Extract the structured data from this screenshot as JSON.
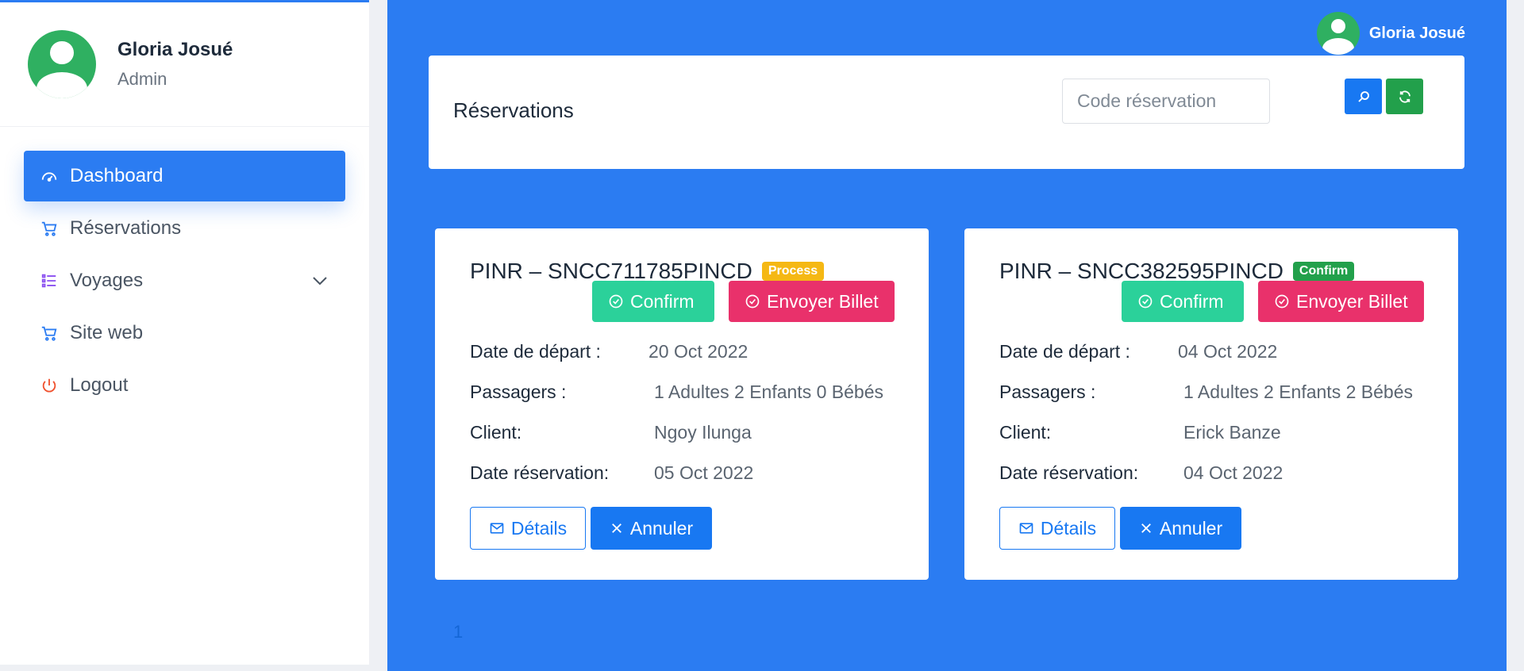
{
  "user": {
    "name": "Gloria Josué",
    "role": "Admin"
  },
  "sidebar": {
    "items": [
      {
        "label": "Dashboard",
        "icon": "dashboard-icon",
        "active": true
      },
      {
        "label": "Réservations",
        "icon": "cart-icon"
      },
      {
        "label": "Voyages",
        "icon": "list-icon",
        "expandable": true
      },
      {
        "label": "Site web",
        "icon": "cart-icon"
      },
      {
        "label": "Logout",
        "icon": "power-icon"
      }
    ]
  },
  "header": {
    "user_name": "Gloria Josué"
  },
  "search": {
    "title": "Réservations",
    "placeholder": "Code réservation"
  },
  "labels": {
    "confirm": "Confirm",
    "send_ticket": "Envoyer Billet",
    "departure": "Date de départ :",
    "passengers": "Passagers :",
    "client": "Client:",
    "reservation_date": "Date réservation:",
    "details": "Détails",
    "cancel": "Annuler"
  },
  "reservations": [
    {
      "code": "PINR – SNCC711785PINCD",
      "status": "Process",
      "departure": "20 Oct 2022",
      "passengers": "1 Adultes 2 Enfants 0 Bébés",
      "client": "Ngoy Ilunga",
      "reservation_date": "05 Oct 2022"
    },
    {
      "code": "PINR – SNCC382595PINCD",
      "status": "Confirm",
      "departure": "04 Oct 2022",
      "passengers": "1 Adultes 2 Enfants 2 Bébés",
      "client": "Erick Banze",
      "reservation_date": "04 Oct 2022"
    }
  ],
  "pagination": {
    "current": "1"
  },
  "colors": {
    "primary": "#2b7cf2",
    "success": "#22a04b",
    "teal": "#2bd19a",
    "danger": "#e9316b",
    "warning": "#f5b814"
  }
}
